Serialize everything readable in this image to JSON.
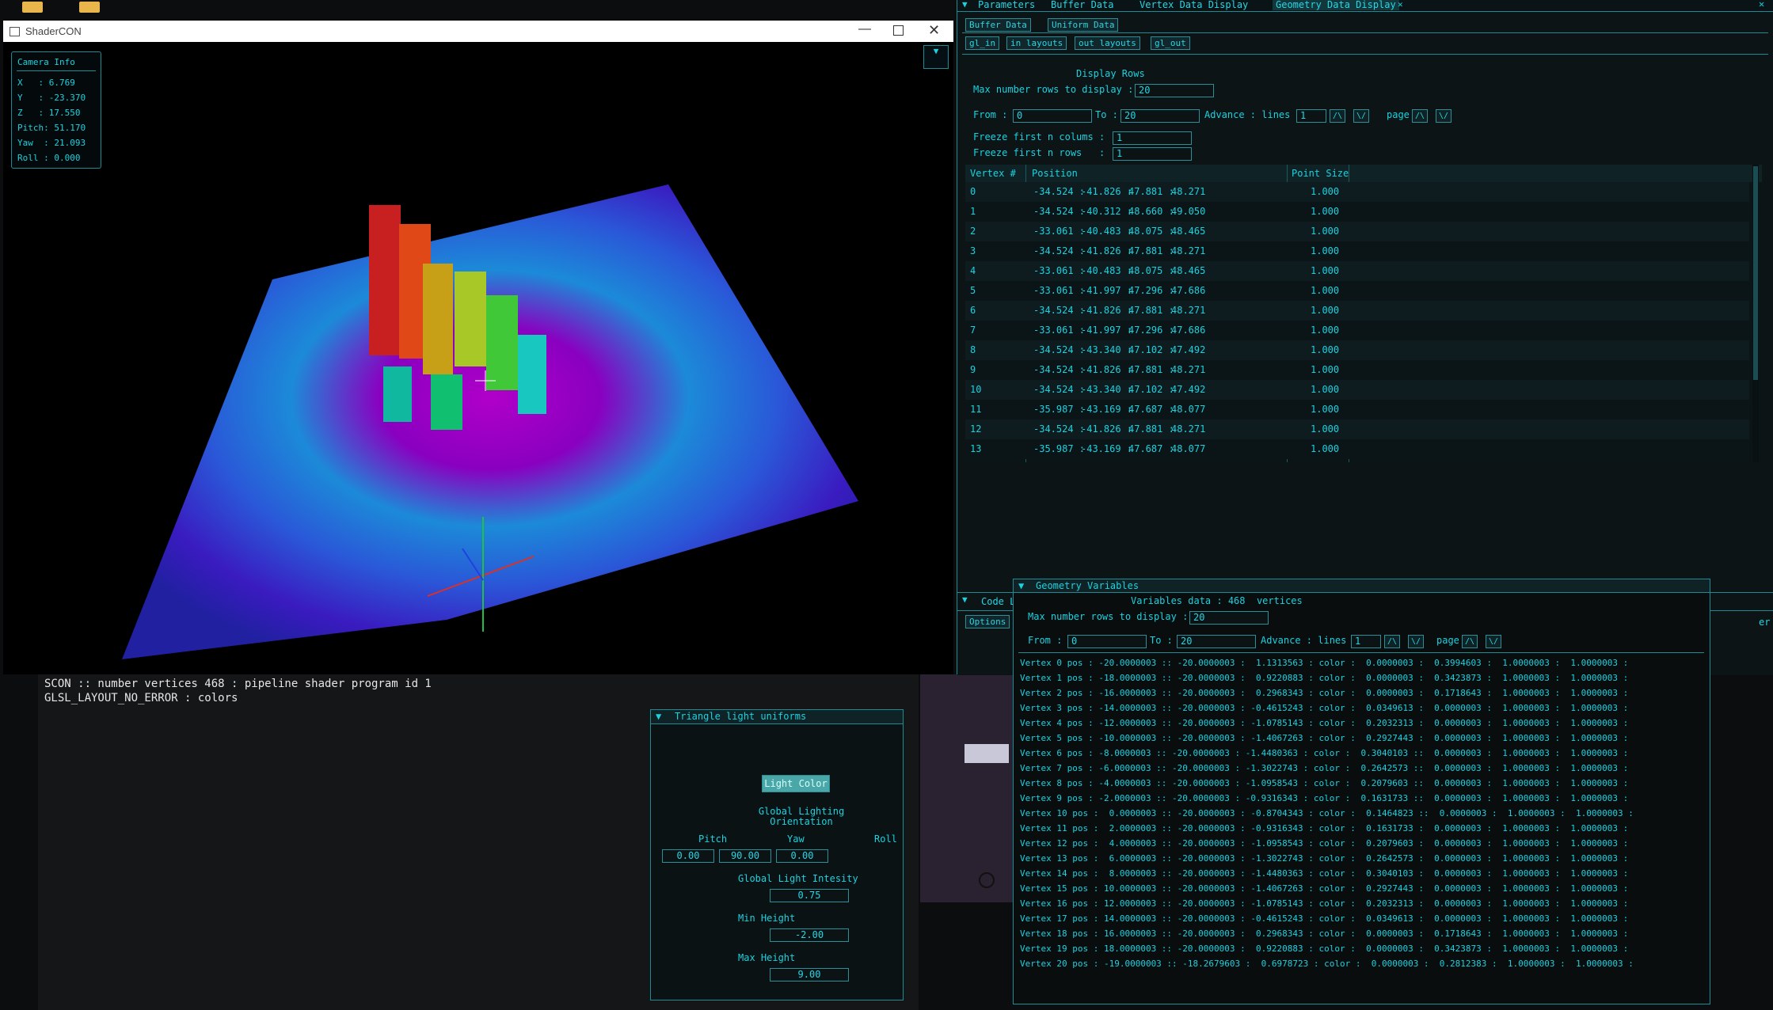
{
  "main_window": {
    "title": "ShaderCON",
    "camera_info": {
      "title": "Camera Info",
      "lines": [
        "X   : 6.769",
        "Y   : -23.370",
        "Z   : 17.550",
        "Pitch: 51.170",
        "Yaw  : 21.093",
        "Roll : 0.000"
      ]
    }
  },
  "console": {
    "lines": [
      "SCON :: number vertices 468 : pipeline shader program id 1",
      "GLSL_LAYOUT_NO_ERROR : colors"
    ]
  },
  "light_panel": {
    "title": "Triangle light uniforms",
    "light_color_button": "Light Color",
    "orientation_label": "Global Lighting\nOrientation",
    "pitch_label": "Pitch",
    "yaw_label": "Yaw",
    "roll_label": "Roll",
    "pitch_value": "0.00",
    "yaw_value": "90.00",
    "roll_value": "0.00",
    "intensity_label": "Global Light Intesity",
    "intensity_value": "0.75",
    "min_height_label": "Min Height",
    "min_height_value": "-2.00",
    "max_height_label": "Max Height",
    "max_height_value": "9.00"
  },
  "right_top": {
    "tabs": [
      "Parameters",
      "Buffer Data",
      "Vertex Data Display",
      "Geometry Data Display"
    ],
    "subtabs": [
      "Buffer Data",
      "Uniform Data"
    ],
    "subtabs2": [
      "gl_in",
      "in layouts",
      "out layouts",
      "gl_out"
    ],
    "display_rows_title": "Display Rows",
    "max_rows_label": "Max number rows to display :",
    "max_rows_value": "20",
    "from_label": "From :",
    "from_value": "0",
    "to_label": "To :",
    "to_value": "20",
    "advance_label": "Advance : lines",
    "advance_value": "1",
    "page_label": "page",
    "freeze_cols_label": "Freeze first n colums :",
    "freeze_cols_value": "1",
    "freeze_rows_label": "Freeze first n rows   :",
    "freeze_rows_value": "1",
    "table_headers": [
      "Vertex #",
      "Position",
      "Point Size"
    ],
    "rows": [
      [
        "0",
        "-34.524 :",
        "-41.826 :",
        "47.881 :",
        "48.271",
        "1.000"
      ],
      [
        "1",
        "-34.524 :",
        "-40.312 :",
        "48.660 :",
        "49.050",
        "1.000"
      ],
      [
        "2",
        "-33.061 :",
        "-40.483 :",
        "48.075 :",
        "48.465",
        "1.000"
      ],
      [
        "3",
        "-34.524 :",
        "-41.826 :",
        "47.881 :",
        "48.271",
        "1.000"
      ],
      [
        "4",
        "-33.061 :",
        "-40.483 :",
        "48.075 :",
        "48.465",
        "1.000"
      ],
      [
        "5",
        "-33.061 :",
        "-41.997 :",
        "47.296 :",
        "47.686",
        "1.000"
      ],
      [
        "6",
        "-34.524 :",
        "-41.826 :",
        "47.881 :",
        "48.271",
        "1.000"
      ],
      [
        "7",
        "-33.061 :",
        "-41.997 :",
        "47.296 :",
        "47.686",
        "1.000"
      ],
      [
        "8",
        "-34.524 :",
        "-43.340 :",
        "47.102 :",
        "47.492",
        "1.000"
      ],
      [
        "9",
        "-34.524 :",
        "-41.826 :",
        "47.881 :",
        "48.271",
        "1.000"
      ],
      [
        "10",
        "-34.524 :",
        "-43.340 :",
        "47.102 :",
        "47.492",
        "1.000"
      ],
      [
        "11",
        "-35.987 :",
        "-43.169 :",
        "47.687 :",
        "48.077",
        "1.000"
      ],
      [
        "12",
        "-34.524 :",
        "-41.826 :",
        "47.881 :",
        "48.271",
        "1.000"
      ],
      [
        "13",
        "-35.987 :",
        "-43.169 :",
        "47.687 :",
        "48.077",
        "1.000"
      ]
    ]
  },
  "code_window": {
    "tab_label": "Code L",
    "options_label": "Options",
    "right_fragment": "er"
  },
  "geometry_variables": {
    "title": "Geometry Variables",
    "subtitle": "Variables data : 468  vertices",
    "max_rows_label": "Max number rows to display :",
    "max_rows_value": "20",
    "from_label": "From :",
    "from_value": "0",
    "to_label": "To :",
    "to_value": "20",
    "advance_label": "Advance : lines",
    "advance_value": "1",
    "page_label": "page",
    "lines": [
      "Vertex 0 pos : -20.0000003 :: -20.0000003 :  1.1313563 : color :  0.0000003 :  0.3994603 :  1.0000003 :  1.0000003 :",
      "Vertex 1 pos : -18.0000003 :: -20.0000003 :  0.9220883 : color :  0.0000003 :  0.3423873 :  1.0000003 :  1.0000003 :",
      "Vertex 2 pos : -16.0000003 :: -20.0000003 :  0.2968343 : color :  0.0000003 :  0.1718643 :  1.0000003 :  1.0000003 :",
      "Vertex 3 pos : -14.0000003 :: -20.0000003 : -0.4615243 : color :  0.0349613 :  0.0000003 :  1.0000003 :  1.0000003 :",
      "Vertex 4 pos : -12.0000003 :: -20.0000003 : -1.0785143 : color :  0.2032313 :  0.0000003 :  1.0000003 :  1.0000003 :",
      "Vertex 5 pos : -10.0000003 :: -20.0000003 : -1.4067263 : color :  0.2927443 :  0.0000003 :  1.0000003 :  1.0000003 :",
      "Vertex 6 pos : -8.0000003 :: -20.0000003 : -1.4480363 : color :  0.3040103 ::  0.0000003 :  1.0000003 :  1.0000003 :",
      "Vertex 7 pos : -6.0000003 :: -20.0000003 : -1.3022743 : color :  0.2642573 ::  0.0000003 :  1.0000003 :  1.0000003 :",
      "Vertex 8 pos : -4.0000003 :: -20.0000003 : -1.0958543 : color :  0.2079603 ::  0.0000003 :  1.0000003 :  1.0000003 :",
      "Vertex 9 pos : -2.0000003 :: -20.0000003 : -0.9316343 : color :  0.1631733 ::  0.0000003 :  1.0000003 :  1.0000003 :",
      "Vertex 10 pos :  0.0000003 :: -20.0000003 : -0.8704343 : color :  0.1464823 ::  0.0000003 :  1.0000003 :  1.0000003 :",
      "Vertex 11 pos :  2.0000003 :: -20.0000003 : -0.9316343 : color :  0.1631733 :  0.0000003 :  1.0000003 :  1.0000003 :",
      "Vertex 12 pos :  4.0000003 :: -20.0000003 : -1.0958543 : color :  0.2079603 :  0.0000003 :  1.0000003 :  1.0000003 :",
      "Vertex 13 pos :  6.0000003 :: -20.0000003 : -1.3022743 : color :  0.2642573 :  0.0000003 :  1.0000003 :  1.0000003 :",
      "Vertex 14 pos :  8.0000003 :: -20.0000003 : -1.4480363 : color :  0.3040103 :  0.0000003 :  1.0000003 :  1.0000003 :",
      "Vertex 15 pos : 10.0000003 :: -20.0000003 : -1.4067263 : color :  0.2927443 :  0.0000003 :  1.0000003 :  1.0000003 :",
      "Vertex 16 pos : 12.0000003 :: -20.0000003 : -1.0785143 : color :  0.2032313 :  0.0000003 :  1.0000003 :  1.0000003 :",
      "Vertex 17 pos : 14.0000003 :: -20.0000003 : -0.4615243 : color :  0.0349613 :  0.0000003 :  1.0000003 :  1.0000003 :",
      "Vertex 18 pos : 16.0000003 :: -20.0000003 :  0.2968343 : color :  0.0000003 :  0.1718643 :  1.0000003 :  1.0000003 :",
      "Vertex 19 pos : 18.0000003 :: -20.0000003 :  0.9220883 : color :  0.0000003 :  0.3423873 :  1.0000003 :  1.0000003 :",
      "Vertex 20 pos : -19.0000003 :: -18.2679603 :  0.6978723 : color :  0.0000003 :  0.2812383 :  1.0000003 :  1.0000003 :"
    ]
  },
  "colors": {
    "accent": "#1ad2e0",
    "panel_border": "#1b8c96",
    "titlebar_bg": "#ffffff",
    "viewport_bg": "#000000"
  }
}
